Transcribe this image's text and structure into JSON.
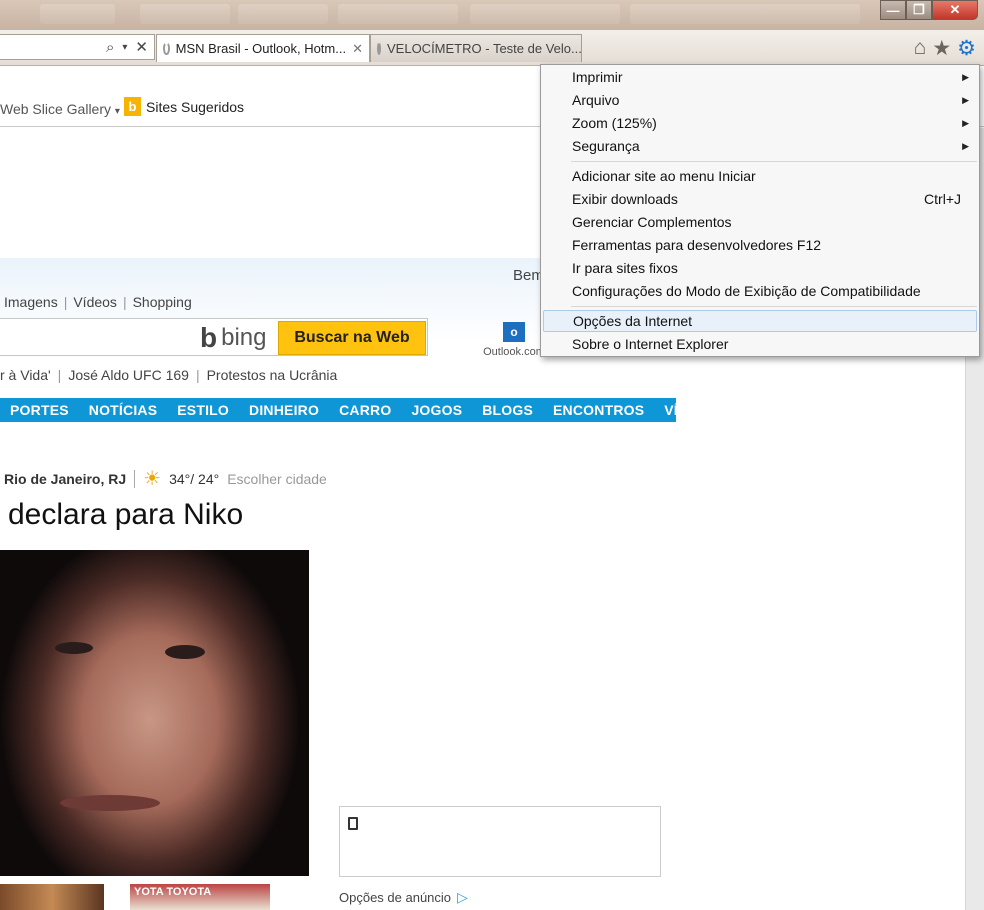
{
  "browser": {
    "tabs": [
      {
        "label": "MSN Brasil - Outlook, Hotm...",
        "active": true
      },
      {
        "label": "VELOCÍMETRO - Teste de Velo...",
        "active": false
      }
    ],
    "window_buttons": {
      "min": "—",
      "max": "❐",
      "close": "✕"
    },
    "toolbar_icons": [
      "home-icon",
      "star-icon",
      "gear-icon"
    ]
  },
  "favorites_bar": {
    "items": [
      "Web Slice Gallery",
      "Sites Sugeridos"
    ]
  },
  "tools_menu": {
    "items": [
      {
        "label": "Imprimir",
        "submenu": true
      },
      {
        "label": "Arquivo",
        "submenu": true
      },
      {
        "label": "Zoom (125%)",
        "submenu": true
      },
      {
        "label": "Segurança",
        "submenu": true
      },
      {
        "label": "Adicionar site ao menu Iniciar"
      },
      {
        "label": "Exibir downloads",
        "shortcut": "Ctrl+J"
      },
      {
        "label": "Gerenciar Complementos"
      },
      {
        "label": "Ferramentas para desenvolvedores F12"
      },
      {
        "label": "Ir para sites fixos"
      },
      {
        "label": "Configurações do Modo de Exibição de Compatibilidade"
      },
      {
        "label": "Opções da Internet",
        "highlighted": true
      },
      {
        "label": "Sobre o Internet Explorer"
      }
    ]
  },
  "msn": {
    "greeting": "Bem",
    "top_links": [
      "Imagens",
      "Vídeos",
      "Shopping"
    ],
    "search": {
      "logo": "bing",
      "button": "Buscar na Web"
    },
    "outlook_label": "Outlook.com",
    "trending": [
      "r à Vida'",
      "José Aldo UFC 169",
      "Protestos na Ucrânia"
    ],
    "nav": [
      "PORTES",
      "NOTÍCIAS",
      "ESTILO",
      "DINHEIRO",
      "CARRO",
      "JOGOS",
      "BLOGS",
      "ENCONTROS",
      "VÍDEO"
    ],
    "weather": {
      "city": "Rio de Janeiro, RJ",
      "temp": "34°/ 24°",
      "choose": "Escolher cidade"
    },
    "headline": "declara para Niko",
    "ad_options": "Opções de anúncio",
    "thumb_text": "YOTA TOYOTA"
  }
}
